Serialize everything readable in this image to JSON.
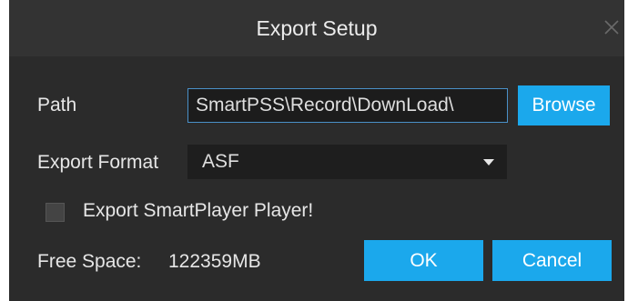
{
  "dialog": {
    "title": "Export Setup",
    "close_icon": "close-icon"
  },
  "path": {
    "label": "Path",
    "value": "SmartPSS\\Record\\DownLoad\\",
    "browse_label": "Browse"
  },
  "format": {
    "label": "Export Format",
    "selected": "ASF",
    "dropdown_icon": "chevron-down-icon"
  },
  "export_player": {
    "label": "Export SmartPlayer Player!",
    "checked": false
  },
  "free_space": {
    "label": "Free Space:",
    "value": "122359MB"
  },
  "buttons": {
    "ok_label": "OK",
    "cancel_label": "Cancel"
  },
  "colors": {
    "accent": "#1ba8ec",
    "background": "#2b2b2b",
    "titlebar": "#333333"
  }
}
